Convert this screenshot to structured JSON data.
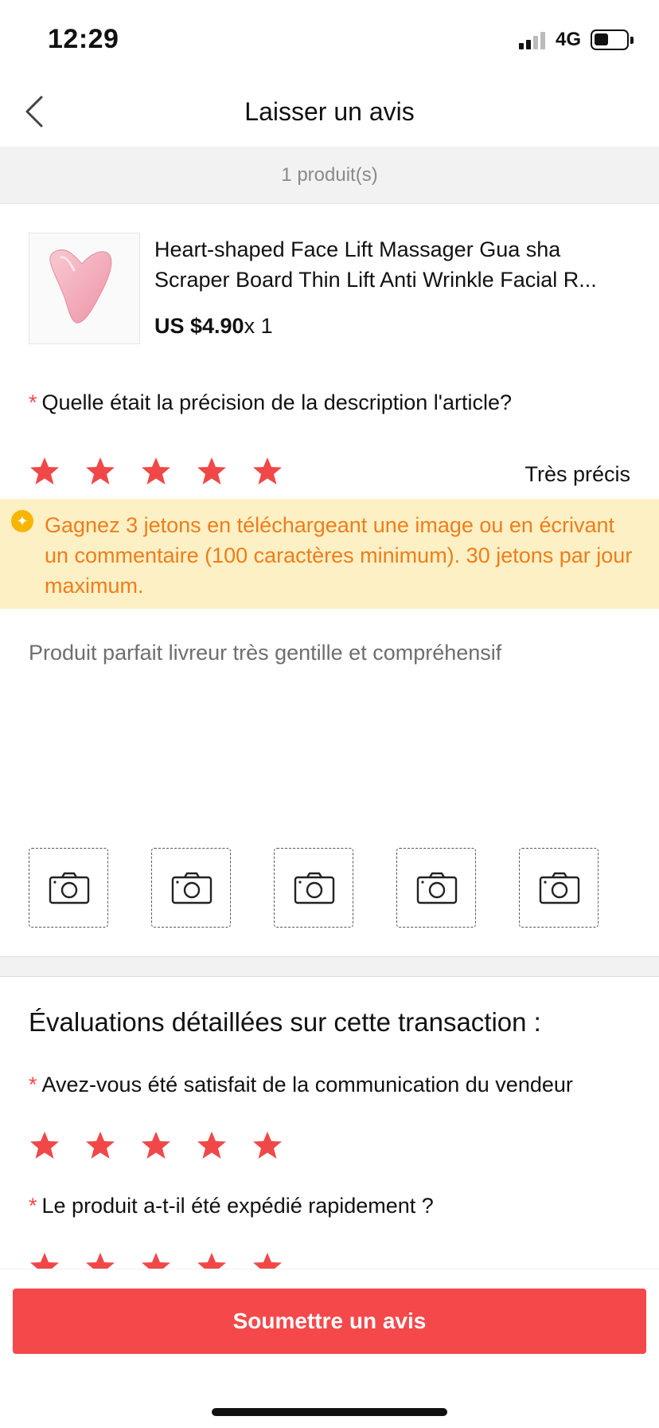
{
  "status_bar": {
    "time": "12:29",
    "network": "4G",
    "signal_bars_active": 2,
    "battery_level_percent": 40
  },
  "nav": {
    "title": "Laisser un avis",
    "back_icon": "chevron-left-icon"
  },
  "product_count": "1 produit(s)",
  "product": {
    "name": "Heart-shaped Face Lift Massager Gua sha Scraper Board Thin Lift Anti Wrinkle Facial R...",
    "price": "US $4.90",
    "quantity": "x 1",
    "thumbnail_icon": "gua-sha-stone-image"
  },
  "questions": {
    "description_accuracy": {
      "required_mark": "*",
      "label": "Quelle était la précision de la description l'article?",
      "rating": 5,
      "max": 5,
      "rating_label": "Très précis"
    },
    "seller_communication": {
      "required_mark": "*",
      "label": "Avez-vous été satisfait de la communication du vendeur",
      "rating": 5,
      "max": 5
    },
    "shipping_speed": {
      "required_mark": "*",
      "label": "Le produit a-t-il été expédié rapidement ?",
      "rating": 5,
      "max": 5
    }
  },
  "banner": {
    "icon": "coin-sparkle-icon",
    "text": "Gagnez 3 jetons en téléchargeant une image ou en écrivant un commentaire (100 caractères minimum). 30 jetons par jour maximum."
  },
  "review": {
    "text": "Produit parfait livreur très gentille et compréhensif"
  },
  "photos": {
    "slot_count": 5,
    "icon": "camera-icon"
  },
  "detail_section_title": "Évaluations détaillées sur cette transaction :",
  "submit_label": "Soumettre un avis",
  "colors": {
    "accent": "#f5484a",
    "star": "#f04848",
    "banner_bg": "#fdf0c4",
    "banner_text": "#f07d1a"
  }
}
